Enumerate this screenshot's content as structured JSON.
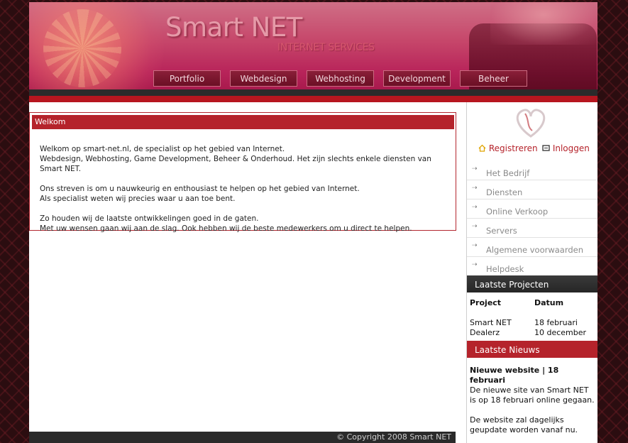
{
  "header": {
    "title": "Smart NET",
    "subtitle": "INTERNET SERVICES",
    "nav": [
      "Portfolio",
      "Webdesign",
      "Webhosting",
      "Development",
      "Beheer"
    ]
  },
  "welcome": {
    "heading": "Welkom",
    "lines": [
      "Welkom op smart-net.nl, de specialist op het gebied van Internet.",
      "Webdesign, Webhosting, Game Development, Beheer & Onderhoud. Het zijn slechts enkele diensten van Smart NET.",
      "Ons streven is om u nauwkeurig en enthousiast te helpen op het gebied van Internet.",
      "Als specialist weten wij precies waar u aan toe bent.",
      "Zo houden wij de laatste ontwikkelingen goed in de gaten.",
      "Met uw wensen gaan wij aan de slag. Ook hebben wij de beste medewerkers om u direct te helpen."
    ]
  },
  "sidebar": {
    "register": "Registreren",
    "login": "Inloggen",
    "menu": [
      "Het Bedrijf",
      "Diensten",
      "Online Verkoop",
      "Servers",
      "Algemene voorwaarden",
      "Helpdesk"
    ],
    "projects": {
      "heading": "Laatste Projecten",
      "col_project": "Project",
      "col_date": "Datum",
      "rows": [
        {
          "project": "Smart NET",
          "date": "18 februari"
        },
        {
          "project": "Dealerz",
          "date": "10 december"
        }
      ]
    },
    "news": {
      "heading": "Laatste Nieuws",
      "title": "Nieuwe website | 18 februari",
      "p1": "De nieuwe site van Smart NET is op 18 februari online gegaan.",
      "p2": "De website zal dagelijks geupdate worden vanaf nu."
    }
  },
  "footer": {
    "copyright": "© Copyright 2008 Smart NET"
  },
  "colors": {
    "accent": "#b5232b",
    "dark": "#2a2a2a"
  },
  "icons": [
    "home-icon",
    "login-icon",
    "arrow-icon",
    "emblem-icon"
  ]
}
